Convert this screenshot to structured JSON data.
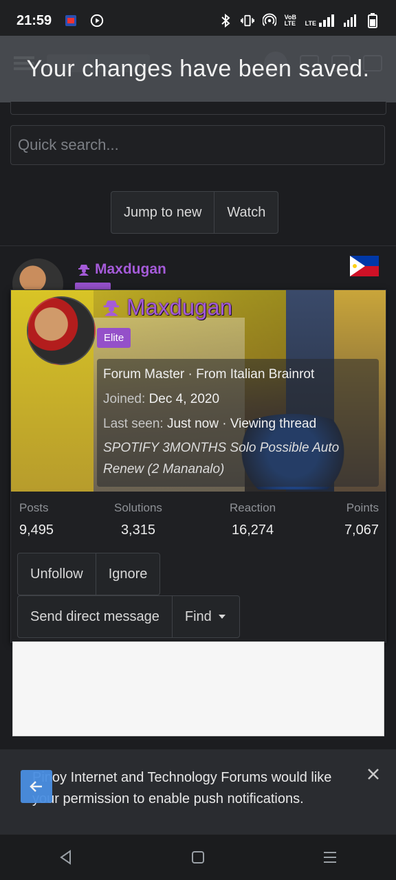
{
  "status_bar": {
    "time": "21:59",
    "icons": [
      "notification-app-icon",
      "media-play-icon",
      "bluetooth-icon",
      "vibrate-icon",
      "hotspot-icon",
      "volte-icon",
      "lte-signal-icon",
      "signal-icon",
      "battery-icon"
    ],
    "volte_text": "VoB LTE",
    "lte_text": "LTE"
  },
  "toast": {
    "message": "Your changes have been saved."
  },
  "search": {
    "placeholder": "Quick search..."
  },
  "thread_actions": {
    "jump_label": "Jump to new",
    "watch_label": "Watch"
  },
  "post": {
    "author": "Maxdugan"
  },
  "member_card": {
    "name": "Maxdugan",
    "badge": "Elite",
    "title_line": "Forum Master · From Italian Brainrot",
    "joined_label": "Joined:",
    "joined_value": "Dec 4, 2020",
    "last_seen_label": "Last seen:",
    "last_seen_value": "Just now · Viewing thread",
    "thread_title": "SPOTIFY 3MONTHS Solo Possible Auto Renew (2 Mananalo)",
    "stats": [
      {
        "label": "Posts",
        "value": "9,495"
      },
      {
        "label": "Solutions",
        "value": "3,315"
      },
      {
        "label": "Reaction",
        "value": "16,274"
      },
      {
        "label": "Points",
        "value": "7,067"
      }
    ],
    "buttons": {
      "unfollow": "Unfollow",
      "ignore": "Ignore",
      "message": "Send direct message",
      "find": "Find"
    }
  },
  "push_prompt": {
    "text": "Pinoy Internet and Technology Forums would like your permission to enable push notifications."
  },
  "colors": {
    "accent_purple": "#a55bd9",
    "elite_badge": "#9450c9",
    "fab_blue": "#4a8fe2"
  }
}
